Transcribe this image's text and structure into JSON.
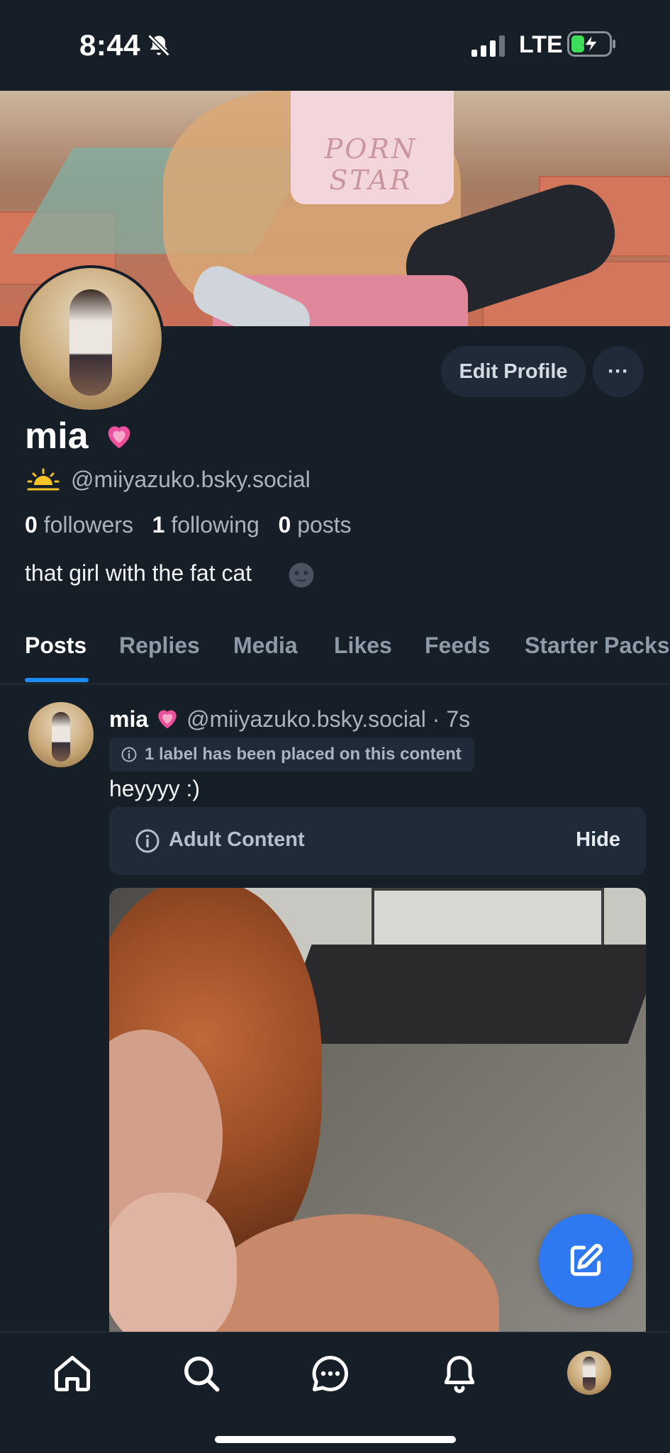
{
  "status_bar": {
    "time": "8:44",
    "network": "LTE",
    "icons": [
      "bell-off-icon",
      "signal-icon",
      "battery-charging-icon"
    ]
  },
  "banner": {
    "shirt_text": "PORN STAR"
  },
  "profile": {
    "display_name": "mia",
    "name_emoji": "heart-icon",
    "handle": "@miiyazuko.bsky.social",
    "followers_count": "0",
    "followers_label": "followers",
    "following_count": "1",
    "following_label": "following",
    "posts_count": "0",
    "posts_label": "posts",
    "bio": "that girl with the fat cat",
    "edit_profile_label": "Edit Profile",
    "more_label": "···"
  },
  "tabs": [
    "Posts",
    "Replies",
    "Media",
    "Likes",
    "Feeds",
    "Starter Packs"
  ],
  "active_tab": "Posts",
  "post": {
    "author_name": "mia",
    "author_handle": "@miiyazuko.bsky.social",
    "separator": "·",
    "timestamp": "7s",
    "label_notice": "1 label has been placed on this content",
    "text": "heyyyy :)",
    "warning_label": "Adult Content",
    "hide_label": "Hide"
  },
  "bottom_nav": [
    "home-icon",
    "search-icon",
    "chat-icon",
    "bell-icon",
    "profile-avatar"
  ],
  "colors": {
    "background": "#161e27",
    "surface": "#1f2b38",
    "accent": "#1d8cf5",
    "fab": "#2e79f2",
    "muted_text": "#aab4c0"
  }
}
